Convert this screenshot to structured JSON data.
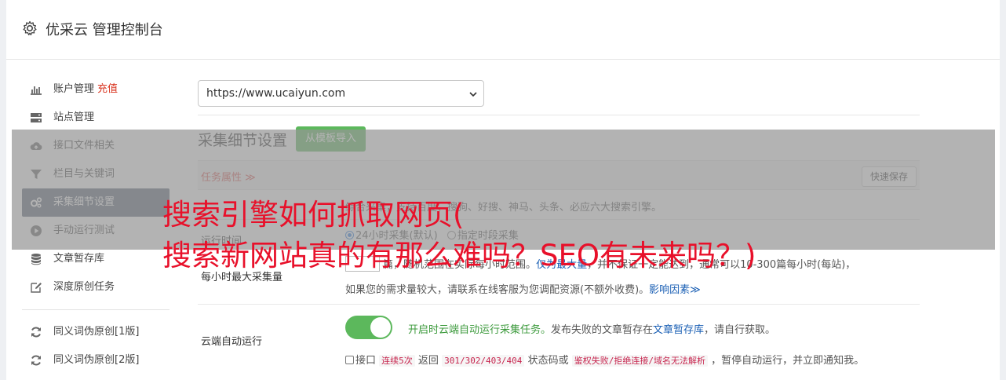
{
  "header": {
    "title": "优采云 管理控制台"
  },
  "sidebar": {
    "items": [
      {
        "label": "账户管理",
        "extra": "充值",
        "icon": "bar-chart-icon"
      },
      {
        "label": "站点管理",
        "icon": "server-icon"
      },
      {
        "label": "接口文件相关",
        "icon": "cloud-upload-icon"
      },
      {
        "label": "栏目与关键词",
        "icon": "filter-icon"
      },
      {
        "label": "采集细节设置",
        "icon": "gears-icon"
      },
      {
        "label": "手动运行测试",
        "icon": "play-circle-icon"
      },
      {
        "label": "文章暂存库",
        "icon": "database-icon"
      },
      {
        "label": "深度原创任务",
        "icon": "edit-icon"
      },
      {
        "label": "同义词伪原创[1版]",
        "icon": "refresh-icon"
      },
      {
        "label": "同义词伪原创[2版]",
        "icon": "refresh-icon"
      }
    ]
  },
  "main": {
    "site_select": "https://www.ucaiyun.com",
    "section_title": "采集细节设置",
    "import_button": "从模板导入",
    "table": {
      "tab_label": "任务属性 ≫",
      "save_button": "快速保存",
      "row0_text_a": "综合采集",
      "row0_text_b": "，支持百度、搜",
      "row0_text_c": "狗、好搜、神马、头条、必应六大搜索引擎。",
      "run_time": {
        "label": "运行时间",
        "option1": "24小时采集(默认)",
        "option2": "指定时段采集"
      },
      "max_collect": {
        "label": "每小时最大采集量",
        "line1_a": "篇，",
        "line1_b": "随机范围",
        "line1_c": "在实际每小时",
        "line1_d": "范围。",
        "line1_e": "仅为最大量",
        "line1_f": "，并不保证一定能达到，通常可以10-300篇每小时(每站)，",
        "line2": "如果您的需求量较大，请联系在线客服为您调配资源(不额外收费)。",
        "link": "影响因素≫"
      },
      "cloud_run": {
        "label": "云端自动运行",
        "desc_a": "开启时云端自动运行采集任务。",
        "desc_b": "发布失败的文章暂存在",
        "desc_link": "文章暂存库",
        "desc_c": "，请自行获取。",
        "check_a": "接口",
        "code1": "连续5次",
        "check_b": "返回",
        "code2": "301/302/403/404",
        "check_c": "状态码或",
        "code3": "鉴权失败/拒绝连接/域名无法解析",
        "check_d": "，暂停自动运行，并立即通知我。"
      }
    }
  },
  "headline": {
    "line1": "搜索引擎如何抓取网页(",
    "line2": "搜索新网站真的有那么难吗？SEO有未来吗？)"
  },
  "colors": {
    "accent_green": "#5cb85c",
    "headline_red": "#e8102a",
    "nav_active": "#5a6577"
  }
}
